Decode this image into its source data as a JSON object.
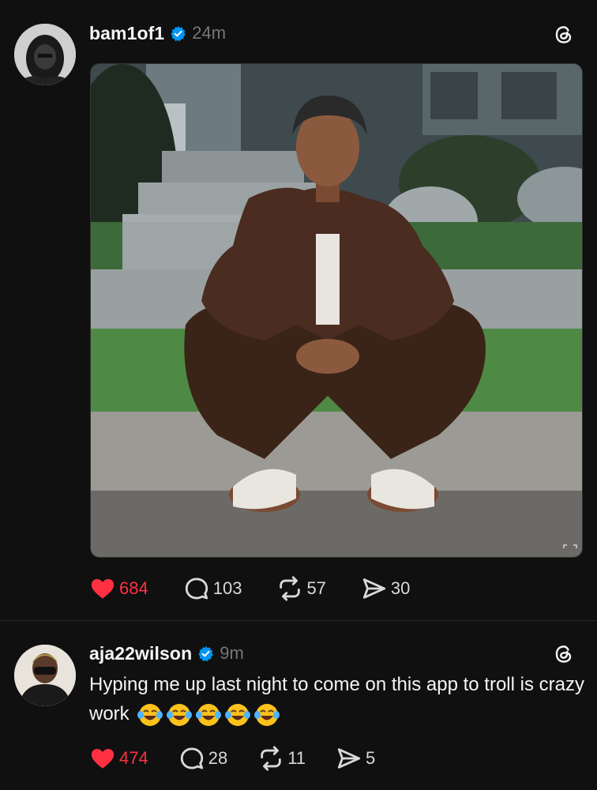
{
  "posts": [
    {
      "username": "bam1of1",
      "time": "24m",
      "likes": "684",
      "replies": "103",
      "reposts": "57",
      "shares": "30"
    },
    {
      "username": "aja22wilson",
      "time": "9m",
      "text": "Hyping me up last night to come on this app to troll is crazy work",
      "likes": "474",
      "replies": "28",
      "reposts": "11",
      "shares": "5"
    }
  ],
  "colors": {
    "background": "#101010",
    "like_red": "#ff3040",
    "verified_blue": "#0095f6",
    "muted": "#777777"
  },
  "icons": [
    "heart-icon",
    "reply-icon",
    "repost-icon",
    "share-icon",
    "threads-logo-icon",
    "verified-badge-icon",
    "expand-icon"
  ]
}
